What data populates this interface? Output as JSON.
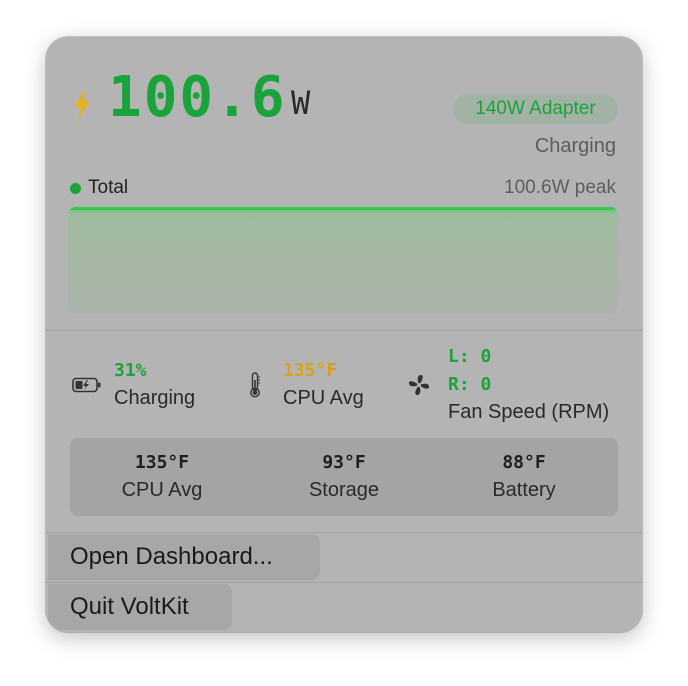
{
  "header": {
    "power_value": "100.6",
    "power_unit": "W",
    "adapter_badge": "140W Adapter",
    "charging_status": "Charging"
  },
  "power_chart": {
    "series_label": "Total",
    "peak_label": "100.6W peak"
  },
  "chart_data": {
    "type": "area",
    "series": [
      {
        "name": "Total",
        "values": [
          100.6,
          100.6,
          100.6,
          100.6,
          100.6,
          100.6
        ]
      }
    ],
    "title": "",
    "xlabel": "",
    "ylabel": "",
    "ylim": [
      0,
      100.6
    ],
    "grid": false,
    "legend": "top-left",
    "colors": {
      "line": "#2ecc4f"
    }
  },
  "stats": {
    "battery": {
      "icon": "battery-charging-icon",
      "value": "31%",
      "label": "Charging"
    },
    "cpu": {
      "icon": "thermometer-icon",
      "value": "135°F",
      "label": "CPU Avg"
    },
    "fans": {
      "icon": "fan-icon",
      "left": "L: 0",
      "right": "R: 0",
      "label": "Fan Speed (RPM)"
    }
  },
  "temperatures": [
    {
      "value": "135°F",
      "label": "CPU Avg"
    },
    {
      "value": "93°F",
      "label": "Storage"
    },
    {
      "value": "88°F",
      "label": "Battery"
    }
  ],
  "menu": {
    "open_dashboard": "Open Dashboard...",
    "quit": "Quit VoltKit"
  },
  "colors": {
    "accent_green": "#1aa33a",
    "warning_yellow": "#d7a318",
    "bolt_yellow": "#e6b21c"
  }
}
